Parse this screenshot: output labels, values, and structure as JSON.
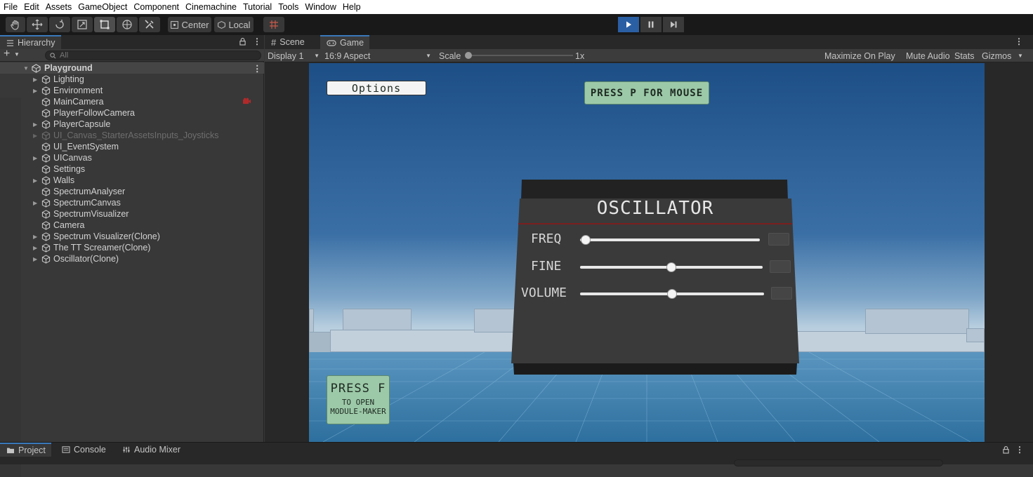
{
  "menu": [
    "File",
    "Edit",
    "Assets",
    "GameObject",
    "Component",
    "Cinemachine",
    "Tutorial",
    "Tools",
    "Window",
    "Help"
  ],
  "toolbar": {
    "pivot_label": "Center",
    "space_label": "Local"
  },
  "hierarchy": {
    "tab_label": "Hierarchy",
    "search_placeholder": "All",
    "root": "Playground",
    "items": [
      {
        "label": "Lighting"
      },
      {
        "label": "Environment"
      },
      {
        "label": "MainCamera"
      },
      {
        "label": "PlayerFollowCamera"
      },
      {
        "label": "PlayerCapsule"
      },
      {
        "label": "UI_Canvas_StarterAssetsInputs_Joysticks"
      },
      {
        "label": "UI_EventSystem"
      },
      {
        "label": "UICanvas"
      },
      {
        "label": "Settings"
      },
      {
        "label": "Walls"
      },
      {
        "label": "SpectrumAnalyser"
      },
      {
        "label": "SpectrumCanvas"
      },
      {
        "label": "SpectrumVisualizer"
      },
      {
        "label": "Camera"
      },
      {
        "label": "Spectrum Visualizer(Clone)"
      },
      {
        "label": "The TT Screamer(Clone)"
      },
      {
        "label": "Oscillator(Clone)"
      }
    ]
  },
  "game_panel": {
    "tabs": [
      "Scene",
      "Game"
    ],
    "display": "Display 1",
    "aspect": "16:9 Aspect",
    "scale_label": "Scale",
    "scale_value": "1x",
    "maximize": "Maximize On Play",
    "mute": "Mute Audio",
    "stats": "Stats",
    "gizmos": "Gizmos"
  },
  "game_view": {
    "options_button": "Options",
    "mouse_hint": "PRESS P FOR MOUSE",
    "module_hint_title": "PRESS F",
    "module_hint_sub1": "TO OPEN",
    "module_hint_sub2": "MODULE-MAKER",
    "oscillator": {
      "title": "OSCILLATOR",
      "sliders": [
        {
          "label": "FREQ",
          "value": 0.03
        },
        {
          "label": "FINE",
          "value": 0.5
        },
        {
          "label": "VOLUME",
          "value": 0.5
        }
      ]
    }
  },
  "bottom_tabs": [
    "Project",
    "Console",
    "Audio Mixer"
  ]
}
